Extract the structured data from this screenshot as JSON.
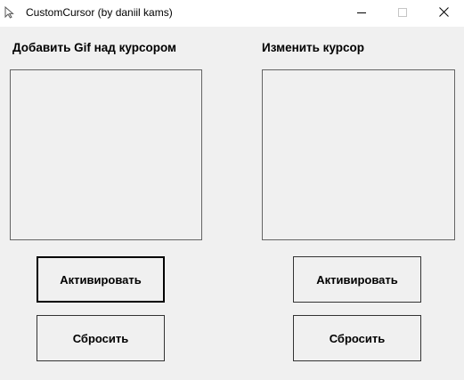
{
  "window": {
    "title": "CustomCursor (by daniil kams)",
    "app_icon": "cursor-arrow-icon",
    "caption_icons": [
      "minimize-icon",
      "maximize-icon",
      "close-icon"
    ]
  },
  "left_panel": {
    "label": "Добавить Gif над курсором",
    "activate_label": "Активировать",
    "reset_label": "Сбросить"
  },
  "right_panel": {
    "label": "Изменить курсор",
    "activate_label": "Активировать",
    "reset_label": "Сбросить"
  },
  "colors": {
    "window_bg": "#f0f0f0",
    "titlebar_bg": "#ffffff",
    "box_border": "#646464"
  }
}
